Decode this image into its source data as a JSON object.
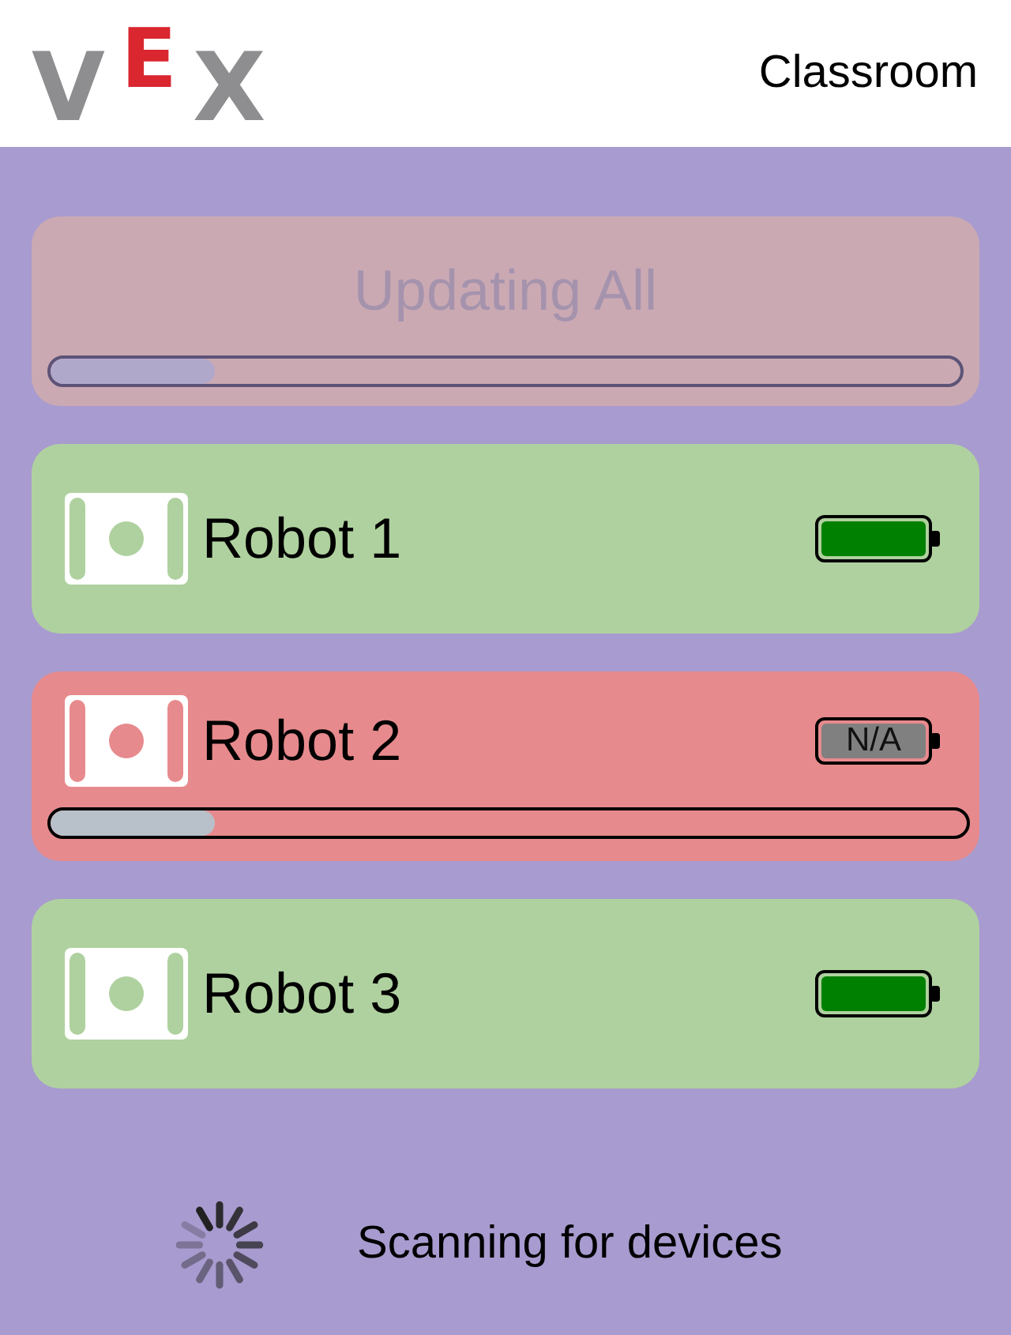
{
  "header": {
    "logo": "VEX",
    "title": "Classroom"
  },
  "update_all": {
    "label": "Updating All",
    "disabled": true,
    "level": 0.18
  },
  "robots": [
    {
      "name": "Robot 1",
      "color": "#afd19f",
      "battery": {
        "kind": "level",
        "level": 1
      },
      "updating": false
    },
    {
      "name": "Robot 2",
      "color": "#e78a8d",
      "battery": {
        "kind": "unknown",
        "text": "N/A"
      },
      "updating": true,
      "level": 0.18
    },
    {
      "name": "Robot 3",
      "color": "#afd19f",
      "battery": {
        "kind": "level",
        "level": 1
      },
      "updating": false
    }
  ],
  "status": {
    "text": "Scanning for devices",
    "busy": true
  }
}
